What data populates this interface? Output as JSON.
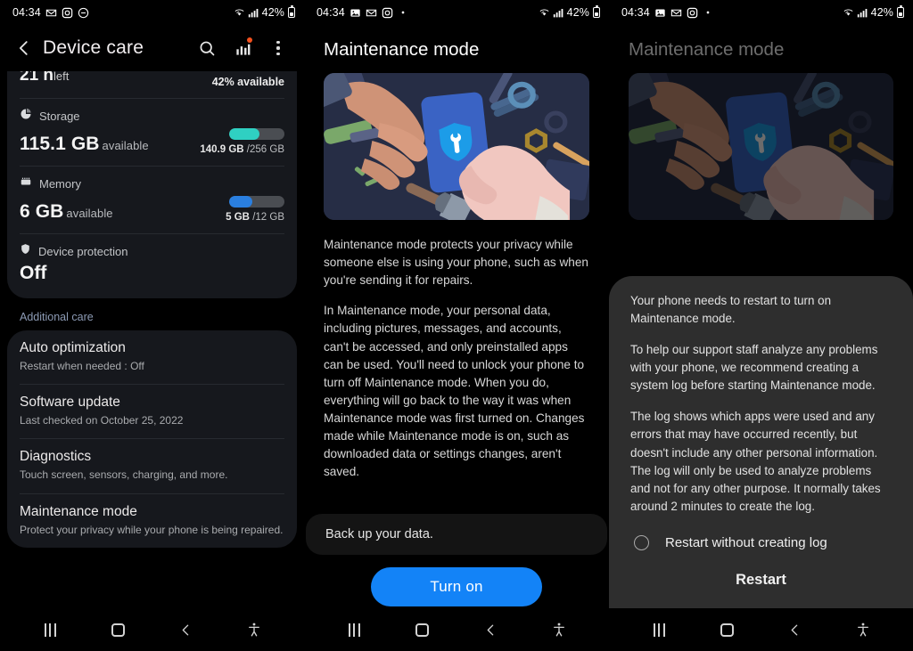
{
  "statusbar": {
    "time": "04:34",
    "battery_text": "42%",
    "icons_left_panel1": [
      "gmail-icon",
      "instagram-icon",
      "minus-circle-icon"
    ],
    "icons_left_panel2": [
      "photo-icon",
      "gmail-icon",
      "instagram-icon",
      "dot-icon"
    ],
    "icons_right": [
      "wifi-calling-icon",
      "signal-icon",
      "battery-icon"
    ]
  },
  "panel1": {
    "header": {
      "title": "Device care",
      "back": "back-arrow",
      "search": "search-icon",
      "stats": "bar-chart-icon",
      "more": "more-options-icon"
    },
    "battery_row": {
      "value": "21 h",
      "unit": "left",
      "right": "42% available"
    },
    "storage": {
      "label": "Storage",
      "icon": "storage-pie-icon",
      "value": "115.1 GB",
      "value_suffix": "available",
      "used": "140.9 GB",
      "total": "/256 GB",
      "percent": 55,
      "bar_color": "#2fd0c2"
    },
    "memory": {
      "label": "Memory",
      "icon": "memory-chip-icon",
      "value": "6 GB",
      "value_suffix": "available",
      "used": "5 GB",
      "total": "/12 GB",
      "percent": 42,
      "bar_color": "#2a7fe0"
    },
    "device_protection": {
      "label": "Device protection",
      "icon": "shield-icon",
      "value": "Off"
    },
    "section_label": "Additional care",
    "items": [
      {
        "title": "Auto optimization",
        "subtitle": "Restart when needed : Off"
      },
      {
        "title": "Software update",
        "subtitle": "Last checked on October 25, 2022"
      },
      {
        "title": "Diagnostics",
        "subtitle": "Touch screen, sensors, charging, and more."
      },
      {
        "title": "Maintenance mode",
        "subtitle": "Protect your privacy while your phone is being repaired."
      }
    ]
  },
  "panel2": {
    "title": "Maintenance mode",
    "illustration": "maintenance-tools-illustration",
    "paragraphs": [
      "Maintenance mode protects your privacy while someone else is using your phone, such as when you're sending it for repairs.",
      "In Maintenance mode, your personal data, including pictures, messages, and accounts, can't be accessed, and only preinstalled apps can be used. You'll need to unlock your phone to turn off Maintenance mode. When you do, everything will go back to the way it was when Maintenance mode was first turned on. Changes made while Maintenance mode is on, such as downloaded data or settings changes, aren't saved."
    ],
    "backup_notice": "Back up your data.",
    "primary_button": "Turn on",
    "primary_button_color": "#1383f7"
  },
  "panel3": {
    "title": "Maintenance mode",
    "dialog": {
      "paragraphs": [
        "Your phone needs to restart to turn on Maintenance mode.",
        "To help our support staff analyze any problems with your phone, we recommend creating a system log before starting Maintenance mode.",
        "The log shows which apps were used and any errors that may have occurred recently, but doesn't include any other personal information. The log will only be used to analyze problems and not for any other purpose. It normally takes around 2 minutes to create the log."
      ],
      "radio_label": "Restart without creating log",
      "radio_selected": false,
      "action": "Restart"
    }
  },
  "navbar": {
    "recents": "recents-icon",
    "home": "home-icon",
    "back": "back-icon",
    "accessibility": "accessibility-icon"
  }
}
